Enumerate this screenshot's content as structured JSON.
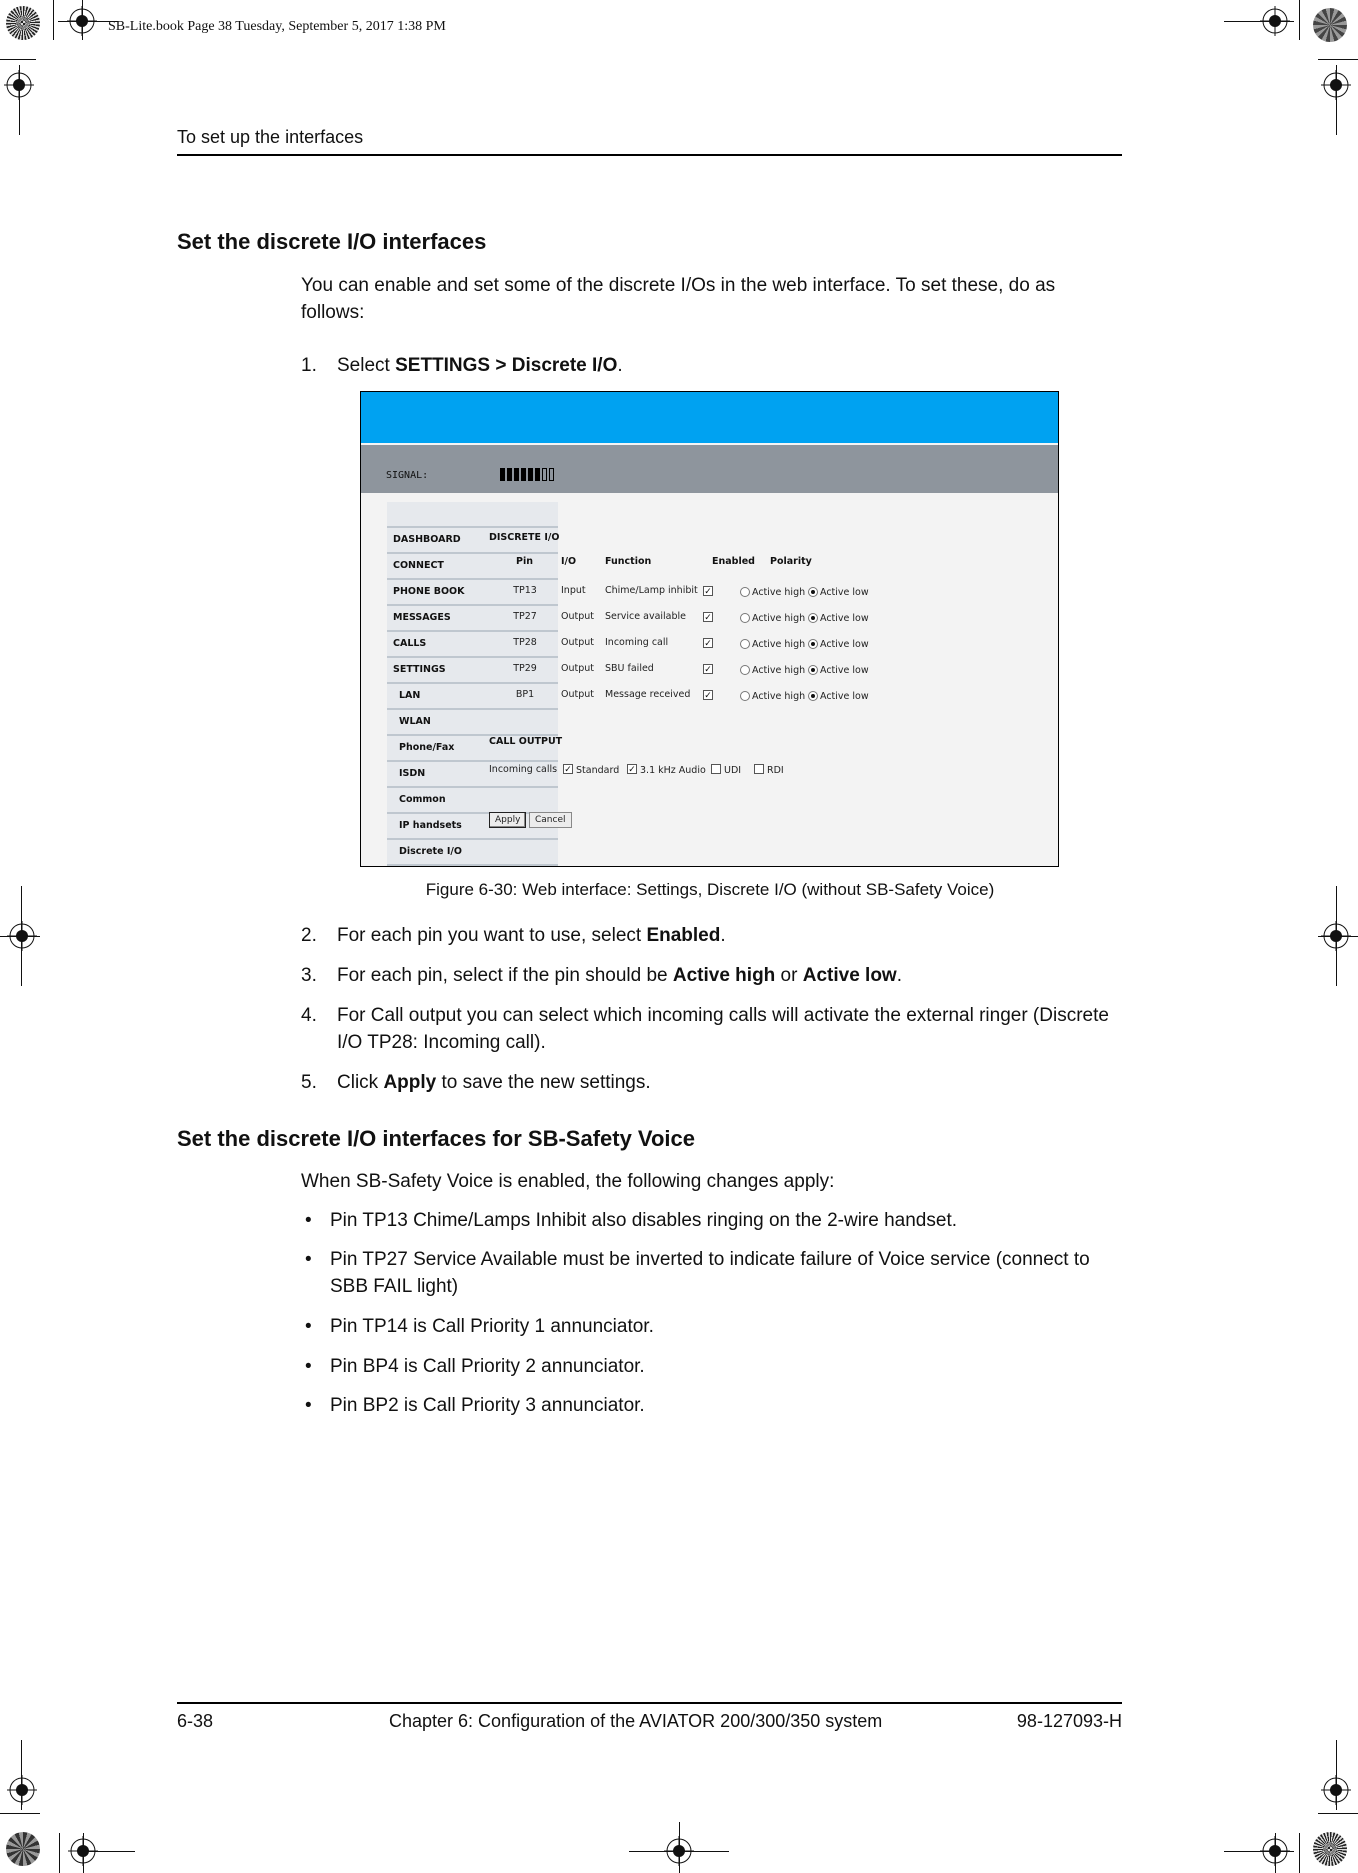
{
  "print_slug": "SB-Lite.book  Page 38  Tuesday, September 5, 2017  1:38 PM",
  "running_header": "To set up the interfaces",
  "section1": {
    "heading": "Set the discrete I/O interfaces",
    "intro": "You can enable and set some of the discrete I/Os in the web interface. To set these, do as follows:",
    "step1": {
      "num": "1.",
      "pre": "Select ",
      "bold": "SETTINGS > Discrete I/O",
      "post": "."
    }
  },
  "figure": {
    "signal_label": "SIGNAL:",
    "signal_strength": {
      "filled_bars": 6,
      "total_bars": 8
    },
    "sidebar": [
      {
        "label": "DASHBOARD",
        "sub": false
      },
      {
        "label": "CONNECT",
        "sub": false
      },
      {
        "label": "PHONE BOOK",
        "sub": false
      },
      {
        "label": "MESSAGES",
        "sub": false
      },
      {
        "label": "CALLS",
        "sub": false
      },
      {
        "label": "SETTINGS",
        "sub": false
      },
      {
        "label": "LAN",
        "sub": true
      },
      {
        "label": "WLAN",
        "sub": true
      },
      {
        "label": "Phone/Fax",
        "sub": true
      },
      {
        "label": "ISDN",
        "sub": true
      },
      {
        "label": "Common",
        "sub": true
      },
      {
        "label": "IP handsets",
        "sub": true
      },
      {
        "label": "Discrete I/O",
        "sub": true
      }
    ],
    "section_title": "DISCRETE I/O",
    "columns": {
      "pin": "Pin",
      "io": "I/O",
      "function": "Function",
      "enabled": "Enabled",
      "polarity": "Polarity"
    },
    "polarity_labels": {
      "high": "Active high",
      "low": "Active low"
    },
    "rows": [
      {
        "pin": "TP13",
        "io": "Input",
        "function": "Chime/Lamp inhibit",
        "enabled": true,
        "polarity": "low"
      },
      {
        "pin": "TP27",
        "io": "Output",
        "function": "Service available",
        "enabled": true,
        "polarity": "low"
      },
      {
        "pin": "TP28",
        "io": "Output",
        "function": "Incoming call",
        "enabled": true,
        "polarity": "low"
      },
      {
        "pin": "TP29",
        "io": "Output",
        "function": "SBU failed",
        "enabled": true,
        "polarity": "low"
      },
      {
        "pin": "BP1",
        "io": "Output",
        "function": "Message received",
        "enabled": true,
        "polarity": "low"
      }
    ],
    "call_output_title": "CALL OUTPUT",
    "incoming_calls_label": "Incoming calls",
    "call_types": [
      {
        "label": "Standard",
        "checked": true
      },
      {
        "label": "3.1 kHz Audio",
        "checked": true
      },
      {
        "label": "UDI",
        "checked": false
      },
      {
        "label": "RDI",
        "checked": false
      }
    ],
    "apply_label": "Apply",
    "cancel_label": "Cancel",
    "colors": {
      "header_blue": "#00a2f1",
      "signal_bar_gray": "#8e959d",
      "sidebar_bg": "#e6e9ed",
      "content_bg": "#f3f3f3"
    }
  },
  "caption": "Figure 6-30: Web interface: Settings, Discrete I/O (without SB-Safety Voice)",
  "steps": [
    {
      "num": "2.",
      "pre": "For each pin you want to use, select ",
      "b1": "Enabled",
      "mid": ".",
      "b2": "",
      "post": ""
    },
    {
      "num": "3.",
      "pre": "For each pin, select if the pin should be ",
      "b1": "Active high",
      "mid": " or ",
      "b2": "Active low",
      "post": "."
    },
    {
      "num": "4.",
      "pre": "For Call output you can select which incoming calls will activate the external ringer (Discrete I/O TP28: Incoming call).",
      "b1": "",
      "mid": "",
      "b2": "",
      "post": ""
    },
    {
      "num": "5.",
      "pre": "Click ",
      "b1": "Apply",
      "mid": " to save the new settings.",
      "b2": "",
      "post": ""
    }
  ],
  "section2": {
    "heading": "Set the discrete I/O interfaces for SB-Safety Voice",
    "intro": "When SB-Safety Voice is enabled, the following changes apply:",
    "bullets": [
      "Pin TP13 Chime/Lamps Inhibit also disables ringing on the 2-wire handset.",
      "Pin TP27 Service Available must be inverted to indicate failure of Voice service (connect to SBB FAIL light)",
      "Pin TP14 is Call Priority 1 annunciator.",
      "Pin BP4 is Call Priority 2 annunciator.",
      "Pin BP2 is Call Priority 3 annunciator."
    ],
    "bullet_glyph": "•"
  },
  "footer": {
    "page": "6-38",
    "chapter": "Chapter 6:  Configuration of the AVIATOR 200/300/350 system",
    "doc_number": "98-127093-H"
  }
}
